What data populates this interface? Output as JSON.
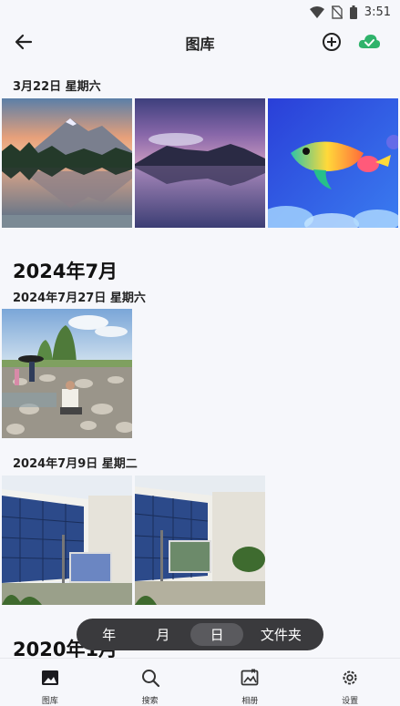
{
  "status": {
    "time": "3:51"
  },
  "app_bar": {
    "title": "图库"
  },
  "sections": {
    "march_date": "3月22日 星期六",
    "july_month": "2024年7月",
    "july27_date": "2024年7月27日 星期六",
    "july9_date": "2024年7月9日 星期二",
    "jan_month": "2020年1月"
  },
  "segmented": {
    "year": "年",
    "month": "月",
    "day": "日",
    "folders": "文件夹",
    "selected": "日"
  },
  "bottom_nav": {
    "gallery": "图库",
    "search": "搜索",
    "albums": "相册",
    "settings": "设置"
  },
  "colors": {
    "accent_cloud": "#2fb36b",
    "segment_bg": "#3a3a3d"
  }
}
